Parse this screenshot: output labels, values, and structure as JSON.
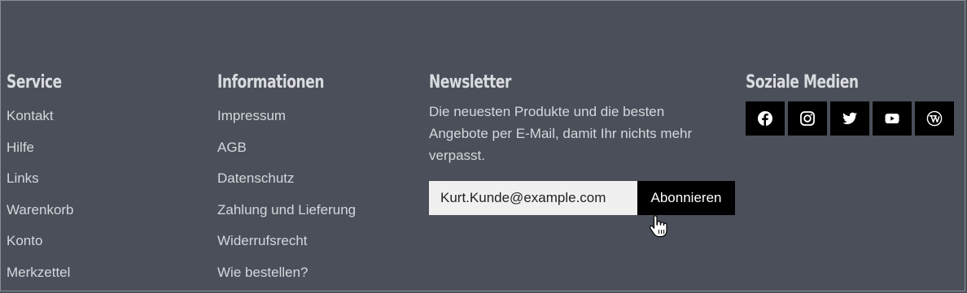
{
  "service": {
    "heading": "Service",
    "links": [
      "Kontakt",
      "Hilfe",
      "Links",
      "Warenkorb",
      "Konto",
      "Merkzettel"
    ]
  },
  "informationen": {
    "heading": "Informationen",
    "links": [
      "Impressum",
      "AGB",
      "Datenschutz",
      "Zahlung und Lieferung",
      "Widerrufsrecht",
      "Wie bestellen?"
    ]
  },
  "newsletter": {
    "heading": "Newsletter",
    "text": "Die neuesten Produkte und die besten Angebote per E-Mail, damit Ihr nichts mehr verpasst.",
    "email_value": "Kurt.Kunde@example.com",
    "subscribe_label": "Abonnieren"
  },
  "social": {
    "heading": "Soziale Medien",
    "icons": [
      "facebook-icon",
      "instagram-icon",
      "twitter-icon",
      "youtube-icon",
      "wordpress-icon"
    ]
  },
  "colors": {
    "background": "#4a4f59",
    "text": "#d5d7db",
    "button": "#000000",
    "input_bg": "#f0f0f0"
  }
}
